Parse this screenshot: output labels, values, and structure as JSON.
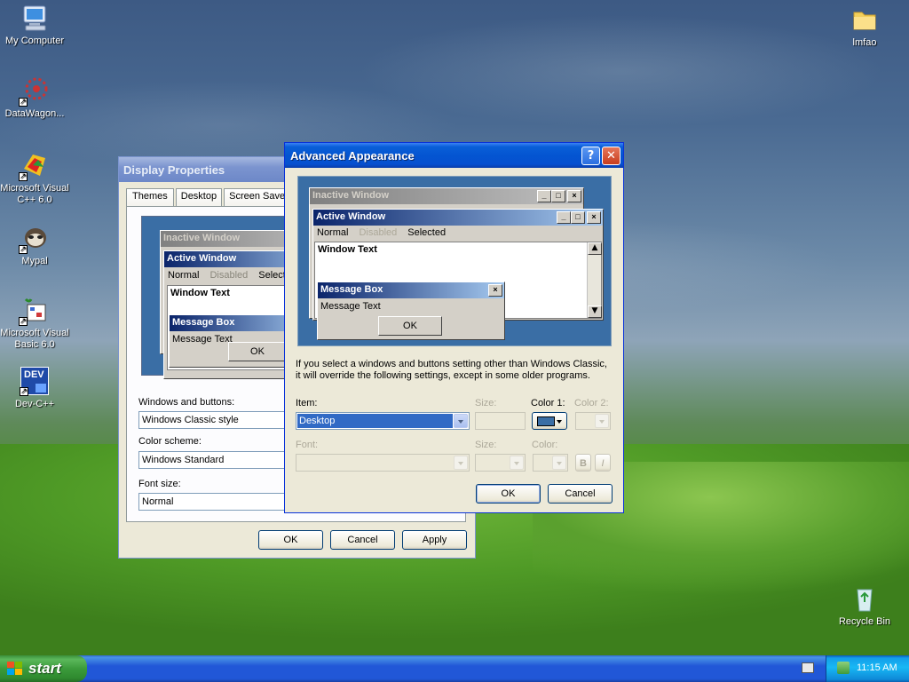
{
  "desktop": {
    "icons": [
      {
        "label": "My Computer"
      },
      {
        "label": "DataWagon..."
      },
      {
        "label": "Microsoft Visual C++ 6.0"
      },
      {
        "label": "Mypal"
      },
      {
        "label": "Microsoft Visual Basic 6.0"
      },
      {
        "label": "Dev-C++"
      },
      {
        "label": "lmfao"
      },
      {
        "label": "Recycle Bin"
      }
    ],
    "devcpp_icon_text": "DEV"
  },
  "display_properties": {
    "title": "Display Properties",
    "tabs": [
      "Themes",
      "Desktop",
      "Screen Saver"
    ],
    "preview": {
      "inactive_title": "Inactive Window",
      "active_title": "Active Window",
      "menu": [
        "Normal",
        "Disabled",
        "Selecte"
      ],
      "window_text": "Window Text",
      "message_box_title": "Message Box",
      "message_text": "Message Text",
      "ok": "OK"
    },
    "windows_buttons_label": "Windows and buttons:",
    "windows_buttons_value": "Windows Classic style",
    "color_scheme_label": "Color scheme:",
    "color_scheme_value": "Windows Standard",
    "font_size_label": "Font size:",
    "font_size_value": "Normal",
    "ok": "OK",
    "cancel": "Cancel",
    "apply": "Apply"
  },
  "advanced_appearance": {
    "title": "Advanced Appearance",
    "help_btn": "?",
    "close_btn": "✕",
    "preview": {
      "inactive_title": "Inactive Window",
      "active_title": "Active Window",
      "menu_normal": "Normal",
      "menu_disabled": "Disabled",
      "menu_selected": "Selected",
      "window_text": "Window Text",
      "message_box_title": "Message Box",
      "message_text": "Message Text",
      "ok": "OK"
    },
    "info_line1": "If you select a windows and buttons setting other than Windows Classic,",
    "info_line2": "it will override the following settings, except in some older programs.",
    "item_label": "Item:",
    "item_value": "Desktop",
    "size_label": "Size:",
    "color1_label": "Color 1:",
    "color2_label": "Color 2:",
    "font_label": "Font:",
    "font_size_label": "Size:",
    "font_color_label": "Color:",
    "bold_btn": "B",
    "italic_btn": "I",
    "ok": "OK",
    "cancel": "Cancel",
    "desktop_color": "#3a6ea5"
  },
  "taskbar": {
    "start_label": "start",
    "clock": "11:15 AM"
  }
}
